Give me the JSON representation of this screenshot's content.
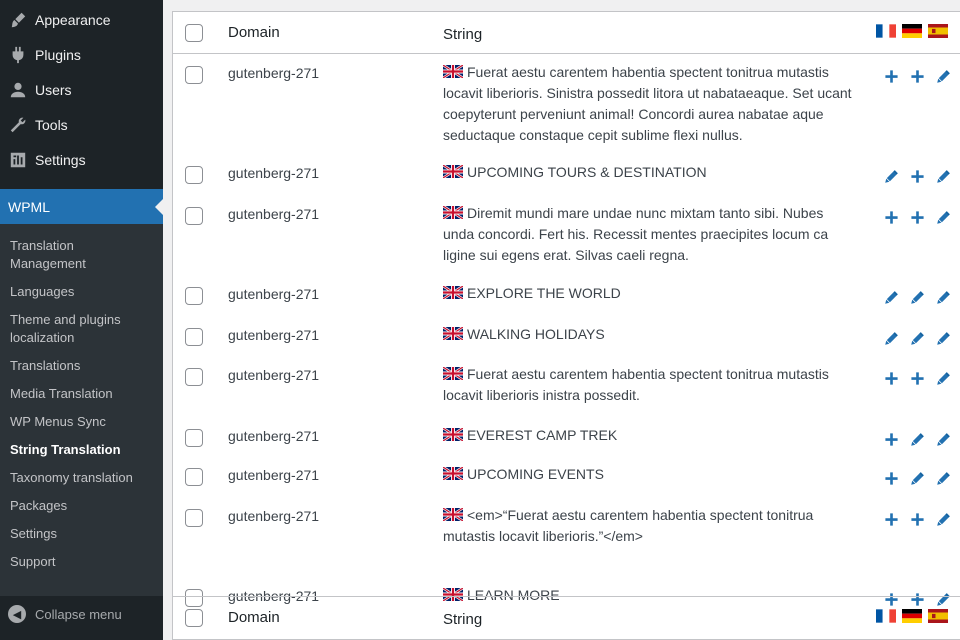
{
  "sidebar": {
    "menu": [
      {
        "label": "Appearance",
        "icon": "paintbrush-icon"
      },
      {
        "label": "Plugins",
        "icon": "plugin-icon"
      },
      {
        "label": "Users",
        "icon": "user-icon"
      },
      {
        "label": "Tools",
        "icon": "wrench-icon"
      },
      {
        "label": "Settings",
        "icon": "settings-icon"
      }
    ],
    "wpml": {
      "label": "WPML",
      "icon": "wpml-icon"
    },
    "submenu": [
      "Translation Management",
      "Languages",
      "Theme and plugins localization",
      "Translations",
      "Media Translation",
      "WP Menus Sync",
      "String Translation",
      "Taxonomy translation",
      "Packages",
      "Settings",
      "Support"
    ],
    "current_submenu": "String Translation",
    "collapse_label": "Collapse menu"
  },
  "table": {
    "headers": {
      "domain": "Domain",
      "string": "String"
    },
    "language_flags": [
      "fr-flag-icon",
      "de-flag-icon",
      "es-flag-icon"
    ],
    "source_flag": "uk-flag-icon",
    "rows": [
      {
        "domain": "gutenberg-271",
        "string": "Fuerat aestu carentem habentia spectent tonitrua mutastis locavit liberioris. Sinistra possedit litora ut nabataeaque. Set ucant coepyterunt perveniunt animal! Concordi aurea nabatae aque seductaque constaque cepit sublime flexi nullus.",
        "actions": [
          "add",
          "add",
          "edit"
        ]
      },
      {
        "domain": "gutenberg-271",
        "string": "UPCOMING TOURS & DESTINATION",
        "actions": [
          "edit",
          "add",
          "edit"
        ]
      },
      {
        "domain": "gutenberg-271",
        "string": "Diremit mundi mare undae nunc mixtam tanto sibi. Nubes unda concordi. Fert his. Recessit mentes praecipites locum ca ligine sui egens erat. Silvas caeli regna.",
        "actions": [
          "add",
          "add",
          "edit"
        ]
      },
      {
        "domain": "gutenberg-271",
        "string": "EXPLORE THE WORLD",
        "actions": [
          "edit",
          "edit",
          "edit"
        ]
      },
      {
        "domain": "gutenberg-271",
        "string": "WALKING HOLIDAYS",
        "actions": [
          "edit",
          "edit",
          "edit"
        ]
      },
      {
        "domain": "gutenberg-271",
        "string": "Fuerat aestu carentem habentia spectent tonitrua mutastis locavit liberioris inistra possedit.",
        "actions": [
          "add",
          "add",
          "edit"
        ]
      },
      {
        "domain": "gutenberg-271",
        "string": "EVEREST CAMP TREK",
        "actions": [
          "add",
          "edit",
          "edit"
        ]
      },
      {
        "domain": "gutenberg-271",
        "string": "UPCOMING EVENTS",
        "actions": [
          "add",
          "edit",
          "edit"
        ]
      },
      {
        "domain": "gutenberg-271",
        "string": "<em>“Fuerat aestu carentem habentia spectent tonitrua mutastis locavit liberioris.”</em>",
        "actions": [
          "add",
          "add",
          "edit"
        ]
      },
      {
        "domain": "gutenberg-271",
        "string": "LEARN MORE",
        "actions": [
          "add",
          "add",
          "edit"
        ]
      }
    ]
  },
  "colors": {
    "accent": "#2271b1",
    "sidebar_bg": "#1d2327",
    "submenu_bg": "#2c3338",
    "action": "#2271b1"
  }
}
